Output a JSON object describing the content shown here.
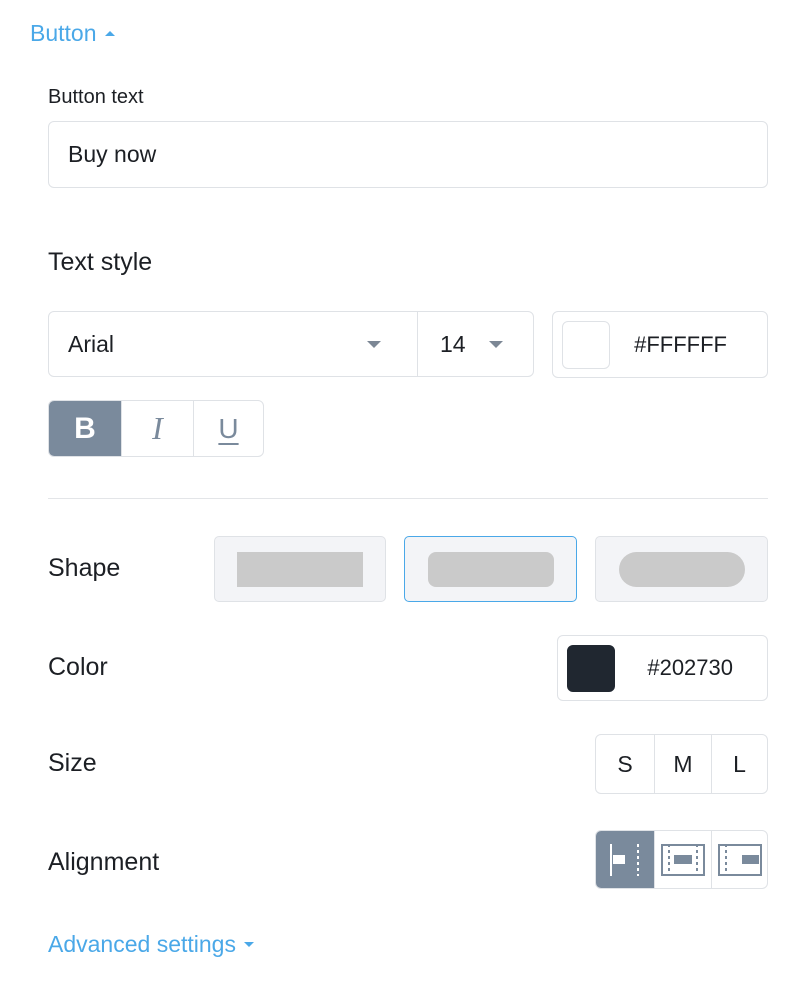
{
  "section": {
    "title": "Button"
  },
  "button_text": {
    "label": "Button text",
    "value": "Buy now"
  },
  "text_style": {
    "label": "Text style",
    "font": "Arial",
    "size": "14",
    "color_hex": "#FFFFFF",
    "swatch_color": "#FFFFFF",
    "format": [
      {
        "name": "bold",
        "glyph": "B",
        "active": true
      },
      {
        "name": "italic",
        "glyph": "I",
        "active": false
      },
      {
        "name": "underline",
        "glyph": "U",
        "active": false
      }
    ]
  },
  "shape": {
    "label": "Shape",
    "options": [
      "square",
      "rounded",
      "pill"
    ],
    "selected": "rounded"
  },
  "color": {
    "label": "Color",
    "hex": "#202730",
    "swatch_color": "#202730"
  },
  "size": {
    "label": "Size",
    "options": [
      "S",
      "M",
      "L"
    ]
  },
  "alignment": {
    "label": "Alignment",
    "options": [
      "left",
      "center",
      "right"
    ],
    "selected": "left"
  },
  "advanced": {
    "label": "Advanced settings"
  },
  "colors": {
    "accent": "#4AA8E8",
    "active_segment": "#7A8A9C",
    "border": "#DFE2E6"
  }
}
